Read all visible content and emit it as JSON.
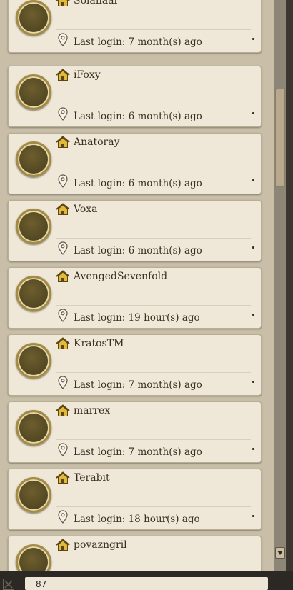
{
  "friends": [
    {
      "name": "Solanaar",
      "last_login": "Last login: 7 month(s) ago"
    },
    {
      "name": "iFoxy",
      "last_login": "Last login: 6 month(s) ago"
    },
    {
      "name": "Anatoray",
      "last_login": "Last login: 6 month(s) ago"
    },
    {
      "name": "Voxa",
      "last_login": "Last login: 6 month(s) ago"
    },
    {
      "name": "AvengedSevenfold",
      "last_login": "Last login: 19 hour(s) ago"
    },
    {
      "name": "KratosTM",
      "last_login": "Last login: 7 month(s) ago"
    },
    {
      "name": "marrex",
      "last_login": "Last login: 7 month(s) ago"
    },
    {
      "name": "Terabit",
      "last_login": "Last login: 18 hour(s) ago"
    },
    {
      "name": "povazngril",
      "last_login": ""
    }
  ],
  "footer": {
    "value": "87"
  },
  "icons": {
    "home": "home-icon",
    "location": "location-pin-icon",
    "scroll_down": "scroll-down-arrow-icon",
    "close": "close-icon"
  },
  "colors": {
    "card_bg": "#efe8d8",
    "panel_bg": "#c9bfa9",
    "text": "#3a2e1e",
    "home_icon": "#e3b93a",
    "avatar_ring": "#a48b45"
  }
}
